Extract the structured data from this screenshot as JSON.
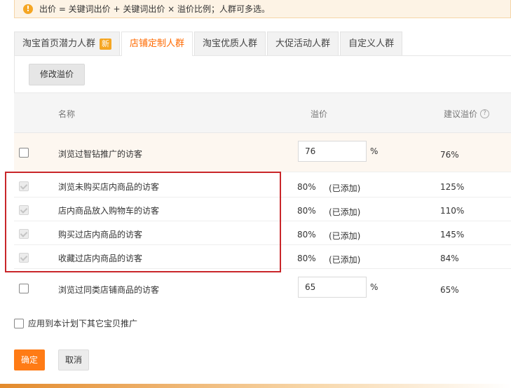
{
  "notice": {
    "icon": "exclamation-icon",
    "text": "出价 = 关键词出价 + 关键词出价 × 溢价比例；人群可多选。"
  },
  "tabs": [
    {
      "label": "淘宝首页潜力人群",
      "badge": "新",
      "active": false
    },
    {
      "label": "店铺定制人群",
      "active": true
    },
    {
      "label": "淘宝优质人群",
      "active": false
    },
    {
      "label": "大促活动人群",
      "active": false
    },
    {
      "label": "自定义人群",
      "active": false
    }
  ],
  "toolbar": {
    "modify_label": "修改溢价"
  },
  "table": {
    "headers": {
      "name": "名称",
      "price": "溢价",
      "suggested": "建议溢价"
    },
    "rows": [
      {
        "name": "浏览过智钻推广的访客",
        "price": "76",
        "unit": "%",
        "suggested": "76%"
      },
      {
        "name": "浏览未购买店内商品的访客",
        "price": "80%",
        "added": "(已添加)",
        "suggested": "125%"
      },
      {
        "name": "店内商品放入购物车的访客",
        "price": "80%",
        "added": "(已添加)",
        "suggested": "110%"
      },
      {
        "name": "购买过店内商品的访客",
        "price": "80%",
        "added": "(已添加)",
        "suggested": "145%"
      },
      {
        "name": "收藏过店内商品的访客",
        "price": "80%",
        "added": "(已添加)",
        "suggested": "84%"
      },
      {
        "name": "浏览过同类店铺商品的访客",
        "price": "65",
        "unit": "%",
        "suggested": "65%"
      }
    ]
  },
  "apply_all": {
    "label": "应用到本计划下其它宝贝推广"
  },
  "actions": {
    "ok_label": "确定",
    "cancel_label": "取消"
  },
  "colors": {
    "accent": "#ff7b15",
    "active_tab": "#ff6a00",
    "highlight_box": "#c9262a"
  }
}
